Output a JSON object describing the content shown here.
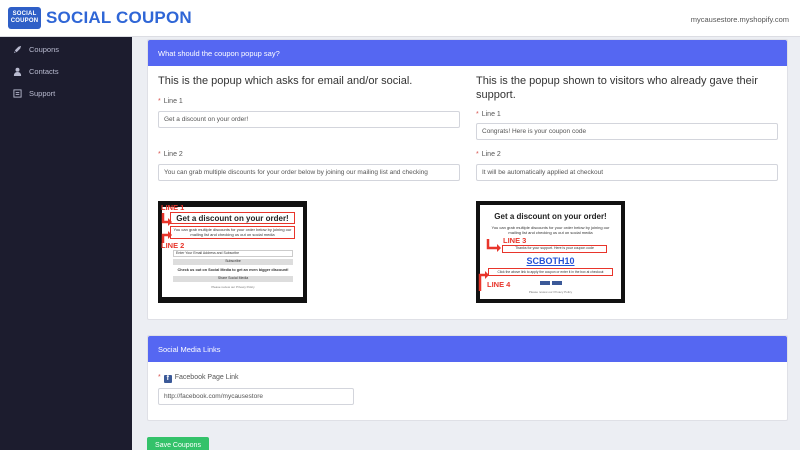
{
  "header": {
    "logo_line1": "SOCIAL",
    "logo_line2": "COUPON",
    "brand": "SOCIAL COUPON",
    "store": "mycausestore.myshopify.com"
  },
  "sidebar": {
    "items": [
      {
        "label": "Coupons",
        "icon": "rocket-icon"
      },
      {
        "label": "Contacts",
        "icon": "user-icon"
      },
      {
        "label": "Support",
        "icon": "list-icon"
      }
    ]
  },
  "popup_section": {
    "header": "What should the coupon popup say?",
    "left": {
      "title": "This is the popup which asks for email and/or social.",
      "line1_label": "Line 1",
      "line1_value": "Get a discount on your order!",
      "line2_label": "Line 2",
      "line2_value": "You can grab multiple discounts for your order below by joining our mailing list and checking"
    },
    "right": {
      "title": "This is the popup shown to visitors who already gave their support.",
      "line1_label": "Line 1",
      "line1_value": "Congrats! Here is your coupon code",
      "line2_label": "Line 2",
      "line2_value": "It will be automatically applied at checkout"
    },
    "preview_left": {
      "line1_tag": "LINE 1",
      "line2_tag": "LINE 2",
      "heading": "Get a discount on your order!",
      "sub": "You can grab multiple discounts for your order below by joining our mailing list and checking us out on social media",
      "email_placeholder": "Enter Your Email Address and Subscribe",
      "subscribe": "Subscribe",
      "social_text": "Check us out on Social Media to get an even bigger discount!",
      "share": "Share Social Media",
      "privacy": "Please review our Privacy Policy"
    },
    "preview_right": {
      "line3_tag": "LINE 3",
      "line4_tag": "LINE 4",
      "heading": "Get a discount on your order!",
      "sub": "You can grab multiple discounts for your order below by joining our mailing list and checking us out on social media",
      "thanks": "Thanks for your support. Here is your coupon code",
      "code": "SCBOTH10",
      "applied": "Click the above link to apply the coupon or enter it in the box at checkout",
      "privacy": "Please review our Privacy Policy"
    }
  },
  "social_section": {
    "header": "Social Media Links",
    "facebook_label": "Facebook Page Link",
    "facebook_value": "http://facebook.com/mycausestore"
  },
  "save_label": "Save Coupons",
  "colors": {
    "accent": "#5567f2",
    "sidebar": "#1c1c2e",
    "brand": "#2f66d6",
    "save": "#34c26a",
    "annotation": "#e8352b"
  }
}
